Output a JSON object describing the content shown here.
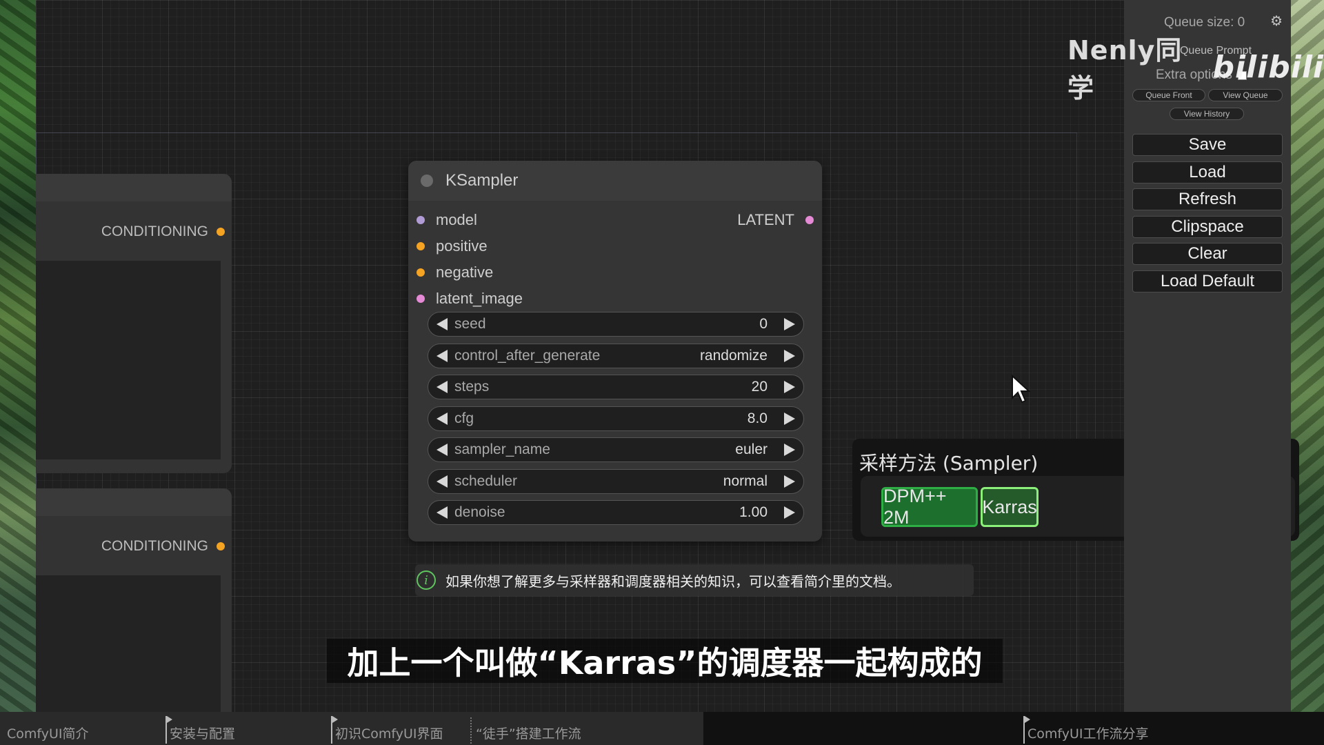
{
  "left_nodes": [
    {
      "output_label": "CONDITIONING"
    },
    {
      "output_label": "CONDITIONING"
    }
  ],
  "ksampler": {
    "title": "KSampler",
    "inputs": [
      "model",
      "positive",
      "negative",
      "latent_image"
    ],
    "output": "LATENT",
    "widgets": [
      {
        "name": "seed",
        "value": "0"
      },
      {
        "name": "control_after_generate",
        "value": "randomize"
      },
      {
        "name": "steps",
        "value": "20"
      },
      {
        "name": "cfg",
        "value": "8.0"
      },
      {
        "name": "sampler_name",
        "value": "euler"
      },
      {
        "name": "scheduler",
        "value": "normal"
      },
      {
        "name": "denoise",
        "value": "1.00"
      }
    ]
  },
  "info": {
    "icon": "info-icon",
    "text": "如果你想了解更多与采样器和调度器相关的知识，可以查看简介里的文档。"
  },
  "sampler_popup": {
    "title": "采样方法 (Sampler)",
    "chip1": "DPM++ 2M",
    "chip2": "Karras"
  },
  "menu": {
    "queue_size": "Queue size: 0",
    "queue_prompt": "Queue Prompt",
    "extra_options": "Extra options",
    "queue_front": "Queue Front",
    "view_queue": "View Queue",
    "view_history": "View History",
    "save": "Save",
    "load": "Load",
    "refresh": "Refresh",
    "clipspace": "Clipspace",
    "clear": "Clear",
    "load_default": "Load Default"
  },
  "watermark": {
    "author": "Nenly同学",
    "logo": "bilibili"
  },
  "subtitle": "加上一个叫做“Karras”的调度器一起构成的",
  "chapters": [
    {
      "label": "ComfyUI简介"
    },
    {
      "label": "安装与配置"
    },
    {
      "label": "初识ComfyUI界面"
    },
    {
      "label": "“徒手”搭建工作流"
    },
    {
      "label": "ComfyUI工作流分享"
    }
  ],
  "colors": {
    "accent_green": "#2fae45",
    "conditioning_orange": "#f5a323",
    "model_purple": "#b29cd6",
    "latent_pink": "#e58ad5"
  }
}
